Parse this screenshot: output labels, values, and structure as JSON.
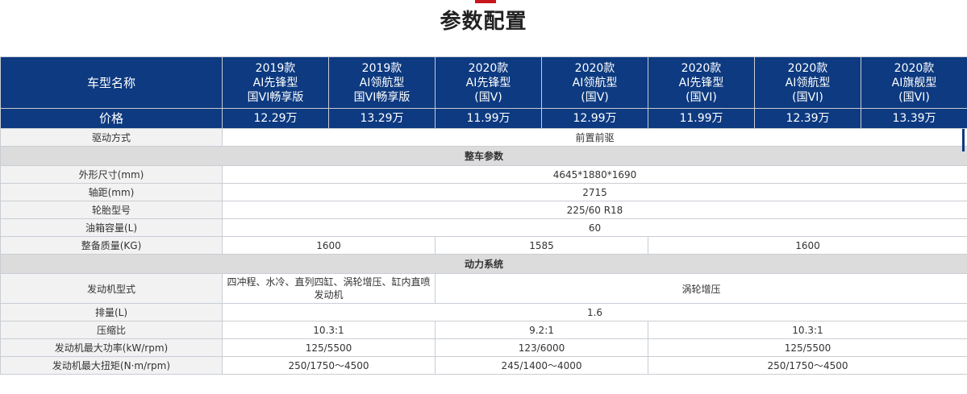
{
  "page": {
    "title": "参数配置"
  },
  "header": {
    "row_label": "车型名称",
    "price_label": "价格",
    "models": [
      {
        "year": "2019款",
        "name": "AI先锋型",
        "spec": "国VI畅享版",
        "price": "12.29万"
      },
      {
        "year": "2019款",
        "name": "AI领航型",
        "spec": "国VI畅享版",
        "price": "13.29万"
      },
      {
        "year": "2020款",
        "name": "AI先锋型",
        "spec": "(国V)",
        "price": "11.99万"
      },
      {
        "year": "2020款",
        "name": "AI领航型",
        "spec": "(国V)",
        "price": "12.99万"
      },
      {
        "year": "2020款",
        "name": "AI先锋型",
        "spec": "(国VI)",
        "price": "11.99万"
      },
      {
        "year": "2020款",
        "name": "AI领航型",
        "spec": "(国VI)",
        "price": "12.39万"
      },
      {
        "year": "2020款",
        "name": "AI旗舰型",
        "spec": "(国VI)",
        "price": "13.39万"
      }
    ]
  },
  "drive": {
    "label": "驱动方式",
    "value": "前置前驱"
  },
  "sections": {
    "vehicle": "整车参数",
    "power": "动力系统"
  },
  "vehicle_rows": {
    "dimensions": {
      "label": "外形尺寸(mm)",
      "value": "4645*1880*1690"
    },
    "wheelbase": {
      "label": "轴距(mm)",
      "value": "2715"
    },
    "tire": {
      "label": "轮胎型号",
      "value": "225/60 R18"
    },
    "fuel_tank": {
      "label": "油箱容量(L)",
      "value": "60"
    },
    "curb_weight": {
      "label": "整备质量(KG)",
      "values": [
        "1600",
        "1585",
        "1600"
      ]
    }
  },
  "power_rows": {
    "engine_type": {
      "label": "发动机型式",
      "values": [
        "四冲程、水冷、直列四缸、涡轮增压、缸内直喷发动机",
        "涡轮增压"
      ]
    },
    "displacement": {
      "label": "排量(L)",
      "value": "1.6"
    },
    "compression": {
      "label": "压缩比",
      "values": [
        "10.3:1",
        "9.2:1",
        "10.3:1"
      ]
    },
    "max_power": {
      "label": "发动机最大功率(kW/rpm)",
      "values": [
        "125/5500",
        "123/6000",
        "125/5500"
      ]
    },
    "max_torque": {
      "label": "发动机最大扭矩(N·m/rpm)",
      "values": [
        "250/1750～4500",
        "245/1400～4000",
        "250/1750～4500"
      ]
    }
  }
}
